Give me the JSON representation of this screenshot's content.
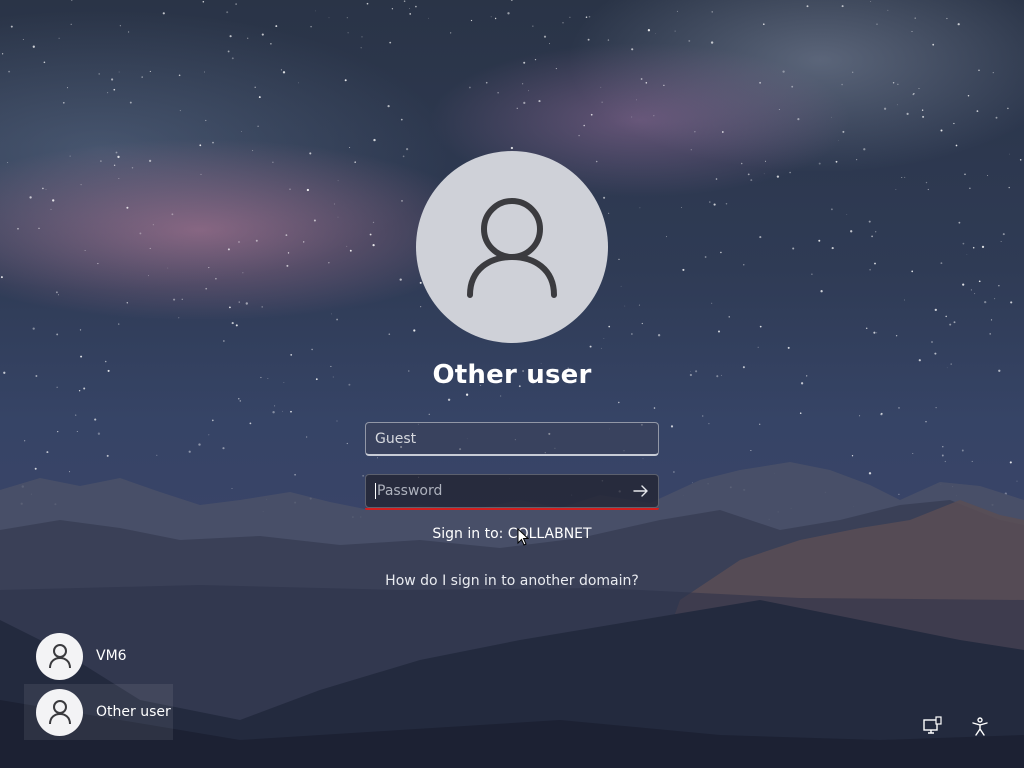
{
  "user": {
    "display_name": "Other user"
  },
  "form": {
    "username_value": "Guest",
    "password_placeholder": "Password",
    "submit_icon": "arrow-right-icon"
  },
  "sign_in_to": "Sign in to: COLLABNET",
  "help_link": "How do I sign in to another domain?",
  "user_list": [
    {
      "name": "VM6",
      "icon": "person-icon"
    },
    {
      "name": "Other user",
      "icon": "person-icon"
    }
  ],
  "corner_icons": [
    "network-icon",
    "accessibility-icon"
  ],
  "colors": {
    "error_underline": "#d11f1f",
    "avatar_bg": "#cfd1d8"
  }
}
